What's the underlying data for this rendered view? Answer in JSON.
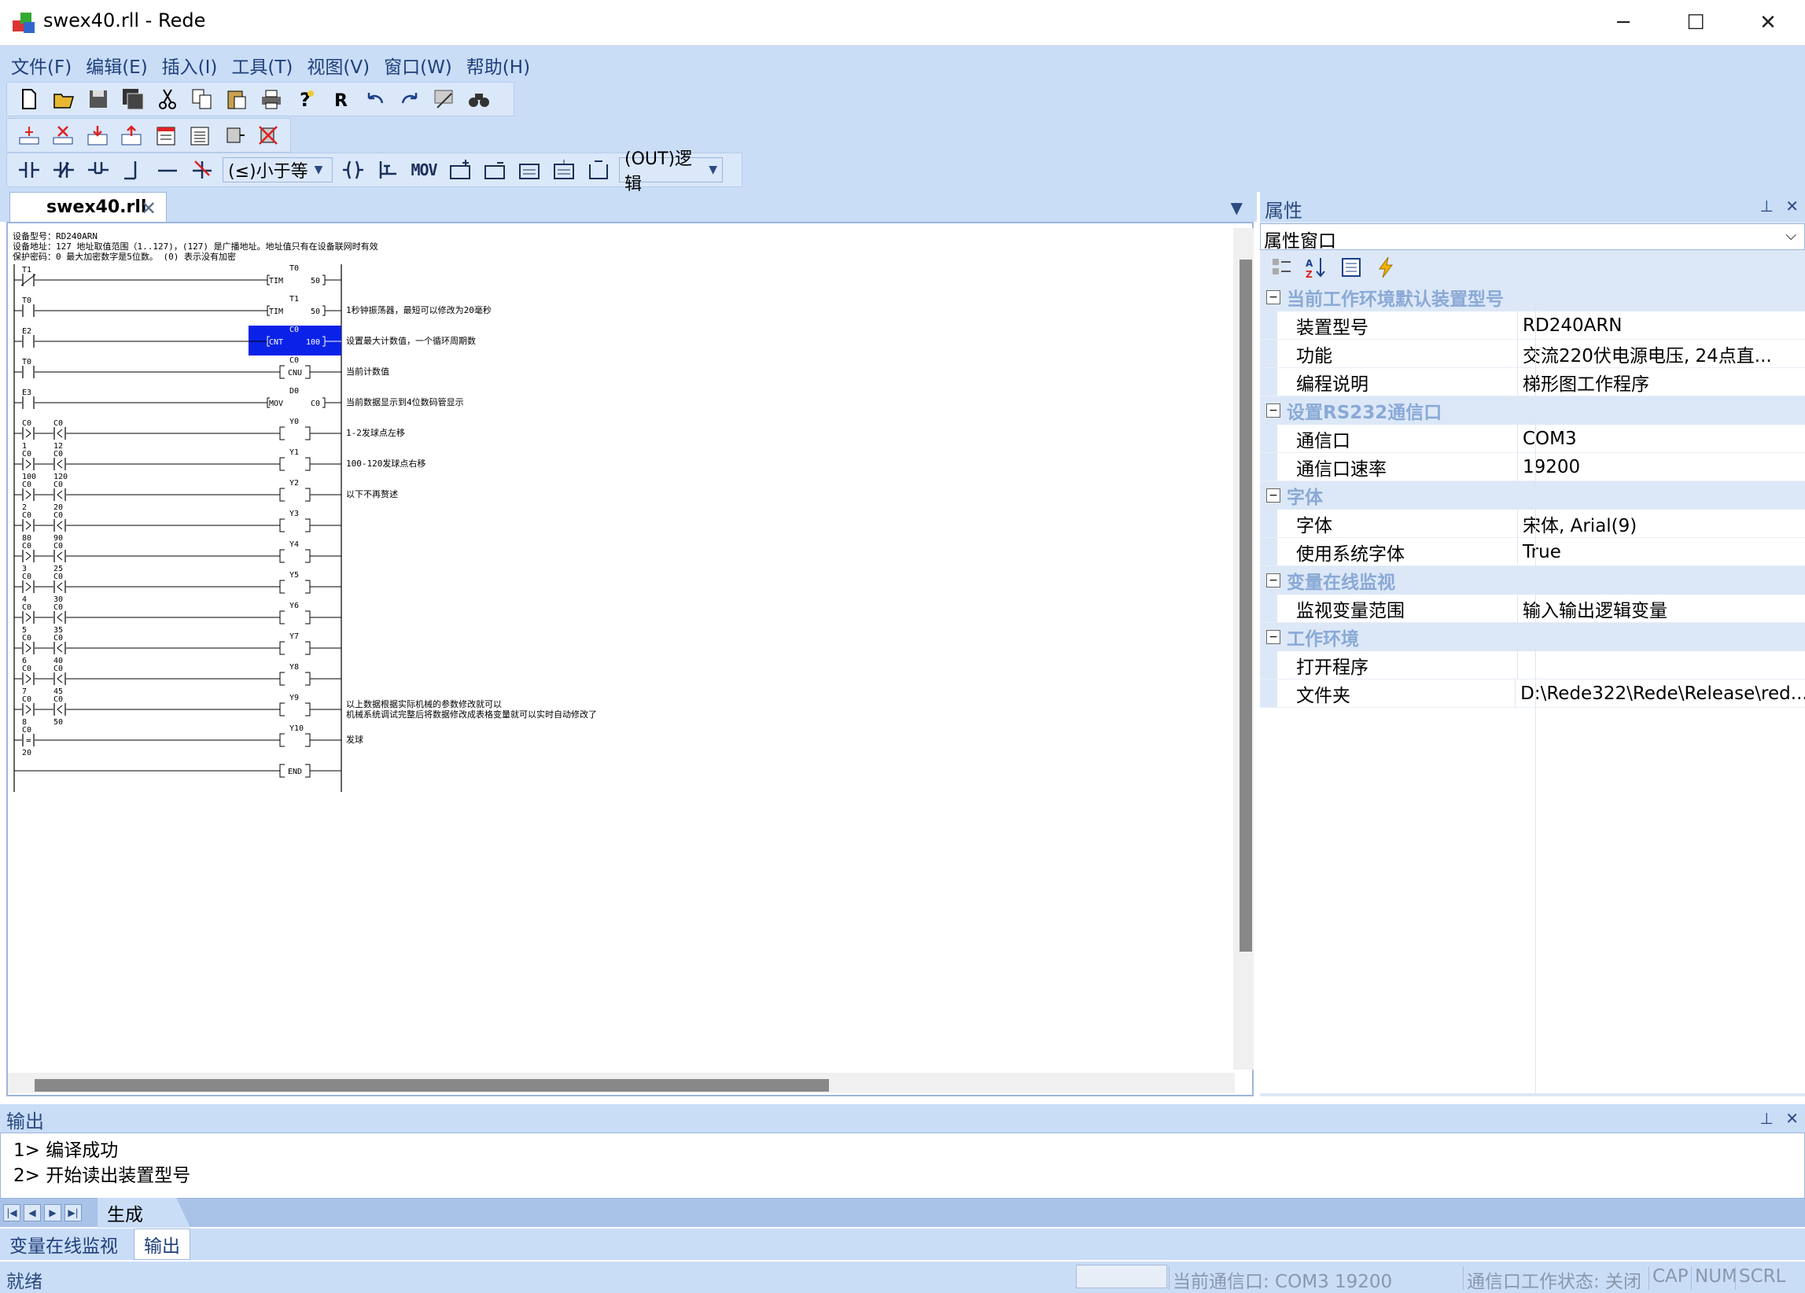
{
  "window": {
    "title": "swex40.rll - Rede",
    "min": "─",
    "max": "☐",
    "close": "✕"
  },
  "menu": [
    "文件(F)",
    "编辑(E)",
    "插入(I)",
    "工具(T)",
    "视图(V)",
    "窗口(W)",
    "帮助(H)"
  ],
  "toolbar2": {
    "compare_combo": "(≤)小于等",
    "out_combo": "(OUT)逻辑"
  },
  "ladder_buttons": [
    "MOV"
  ],
  "doc_tab": {
    "label": "swex40.rll",
    "close": "✕"
  },
  "ladder": {
    "header": [
      "设备型号：RD240ARN",
      "设备地址：127      地址取值范围（1..127)，(127) 是广播地址。地址值只有在设备联网时有效",
      "保护密码：0        最大加密数字是5位数。 (0) 表示没有加密"
    ],
    "rungs": [
      {
        "contacts": [
          {
            "name": "T1",
            "type": "nc",
            "val": ""
          }
        ],
        "coil": {
          "name": "T0",
          "op": "TIM",
          "val": "50"
        },
        "comment": ""
      },
      {
        "contacts": [
          {
            "name": "T0",
            "type": "no",
            "val": ""
          }
        ],
        "coil": {
          "name": "T1",
          "op": "TIM",
          "val": "50"
        },
        "comment": "1秒钟振荡器，最短可以修改为20毫秒"
      },
      {
        "contacts": [
          {
            "name": "E2",
            "type": "no",
            "val": ""
          }
        ],
        "coil": {
          "name": "C0",
          "op": "CNT",
          "val": "100"
        },
        "comment": "设置最大计数值，一个循环周期数",
        "selected": true
      },
      {
        "contacts": [
          {
            "name": "T0",
            "type": "no",
            "val": ""
          }
        ],
        "coil": {
          "name": "C0",
          "op": "CNU",
          "val": ""
        },
        "comment": "当前计数值"
      },
      {
        "contacts": [
          {
            "name": "E3",
            "type": "no",
            "val": ""
          }
        ],
        "coil": {
          "name": "D0",
          "op": "MOV",
          "val": "C0"
        },
        "comment": "当前数据显示到4位数码管显示"
      },
      {
        "contacts": [
          {
            "name": "C0",
            "type": "gt",
            "val": "1"
          },
          {
            "name": "C0",
            "type": "lt",
            "val": "12"
          }
        ],
        "coil": {
          "name": "Y0",
          "op": "",
          "val": ""
        },
        "comment": "1-2发球点左移"
      },
      {
        "contacts": [
          {
            "name": "C0",
            "type": "gt",
            "val": "100"
          },
          {
            "name": "C0",
            "type": "lt",
            "val": "120"
          }
        ],
        "coil": {
          "name": "Y1",
          "op": "",
          "val": ""
        },
        "comment": "100-120发球点右移"
      },
      {
        "contacts": [
          {
            "name": "C0",
            "type": "gt",
            "val": "2"
          },
          {
            "name": "C0",
            "type": "lt",
            "val": "20"
          }
        ],
        "coil": {
          "name": "Y2",
          "op": "",
          "val": ""
        },
        "comment": "以下不再赘述"
      },
      {
        "contacts": [
          {
            "name": "C0",
            "type": "gt",
            "val": "80"
          },
          {
            "name": "C0",
            "type": "lt",
            "val": "90"
          }
        ],
        "coil": {
          "name": "Y3",
          "op": "",
          "val": ""
        },
        "comment": ""
      },
      {
        "contacts": [
          {
            "name": "C0",
            "type": "gt",
            "val": "3"
          },
          {
            "name": "C0",
            "type": "lt",
            "val": "25"
          }
        ],
        "coil": {
          "name": "Y4",
          "op": "",
          "val": ""
        },
        "comment": ""
      },
      {
        "contacts": [
          {
            "name": "C0",
            "type": "gt",
            "val": "4"
          },
          {
            "name": "C0",
            "type": "lt",
            "val": "30"
          }
        ],
        "coil": {
          "name": "Y5",
          "op": "",
          "val": ""
        },
        "comment": ""
      },
      {
        "contacts": [
          {
            "name": "C0",
            "type": "gt",
            "val": "5"
          },
          {
            "name": "C0",
            "type": "lt",
            "val": "35"
          }
        ],
        "coil": {
          "name": "Y6",
          "op": "",
          "val": ""
        },
        "comment": ""
      },
      {
        "contacts": [
          {
            "name": "C0",
            "type": "gt",
            "val": "6"
          },
          {
            "name": "C0",
            "type": "lt",
            "val": "40"
          }
        ],
        "coil": {
          "name": "Y7",
          "op": "",
          "val": ""
        },
        "comment": ""
      },
      {
        "contacts": [
          {
            "name": "C0",
            "type": "gt",
            "val": "7"
          },
          {
            "name": "C0",
            "type": "lt",
            "val": "45"
          }
        ],
        "coil": {
          "name": "Y8",
          "op": "",
          "val": ""
        },
        "comment": ""
      },
      {
        "contacts": [
          {
            "name": "C0",
            "type": "gt",
            "val": "8"
          },
          {
            "name": "C0",
            "type": "lt",
            "val": "50"
          }
        ],
        "coil": {
          "name": "Y9",
          "op": "",
          "val": ""
        },
        "comment": "以上数据根据实际机械的参数修改就可以\n机械系统调试完整后将数据修改成表格变量就可以实时自动修改了"
      },
      {
        "contacts": [
          {
            "name": "C0",
            "type": "eq",
            "val": "20"
          }
        ],
        "coil": {
          "name": "Y10",
          "op": "",
          "val": ""
        },
        "comment": "发球"
      },
      {
        "contacts": [],
        "coil": {
          "name": "",
          "op": "END",
          "val": ""
        },
        "comment": ""
      }
    ]
  },
  "props": {
    "title": "属性",
    "pin": "⊥",
    "close": "✕",
    "combo": "属性窗口",
    "combo_arrow": "⌵",
    "groups": [
      {
        "name": "当前工作环境默认装置型号",
        "rows": [
          [
            "装置型号",
            "RD240ARN"
          ],
          [
            "功能",
            "交流220伏电源电压, 24点直..."
          ],
          [
            "编程说明",
            "梯形图工作程序"
          ]
        ]
      },
      {
        "name": "设置RS232通信口",
        "rows": [
          [
            "通信口",
            "COM3"
          ],
          [
            "通信口速率",
            "19200"
          ]
        ]
      },
      {
        "name": "字体",
        "rows": [
          [
            "字体",
            "宋体, Arial(9)"
          ],
          [
            "使用系统字体",
            "True"
          ]
        ]
      },
      {
        "name": "变量在线监视",
        "rows": [
          [
            "监视变量范围",
            "输入输出逻辑变量"
          ]
        ]
      },
      {
        "name": "工作环境",
        "rows": [
          [
            "打开程序",
            ""
          ],
          [
            "文件夹",
            "D:\\Rede322\\Rede\\Release\\red..."
          ]
        ]
      }
    ]
  },
  "output": {
    "title": "输出",
    "lines": [
      "1> 编译成功",
      "2> 开始读出装置型号"
    ],
    "tab": "生成"
  },
  "bottom_tabs": [
    "变量在线监视",
    "输出"
  ],
  "status": {
    "ready": "就绪",
    "port": "当前通信口: COM3 19200",
    "port_state": "通信口工作状态: 关闭",
    "cap": "CAP",
    "num": "NUM",
    "scrl": "SCRL"
  }
}
